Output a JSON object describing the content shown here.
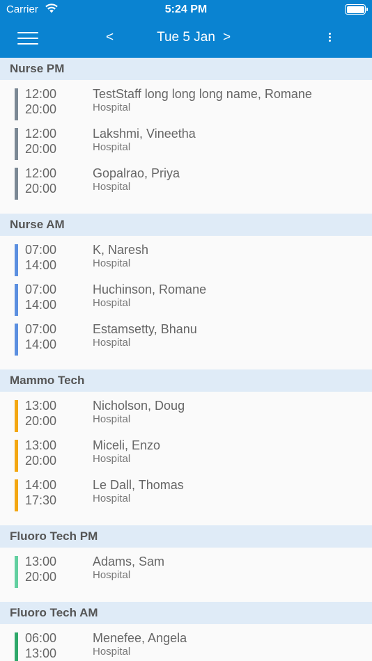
{
  "status": {
    "carrier": "Carrier",
    "time": "5:24 PM"
  },
  "nav": {
    "prev": "<",
    "date": "Tue 5 Jan",
    "next": ">"
  },
  "sections": [
    {
      "title": "Nurse PM",
      "color": "#7b8894",
      "rows": [
        {
          "start": "12:00",
          "end": "20:00",
          "name": "TestStaff long long long name, Romane",
          "place": "Hospital"
        },
        {
          "start": "12:00",
          "end": "20:00",
          "name": "Lakshmi, Vineetha",
          "place": "Hospital"
        },
        {
          "start": "12:00",
          "end": "20:00",
          "name": "Gopalrao, Priya",
          "place": "Hospital"
        }
      ]
    },
    {
      "title": "Nurse AM",
      "color": "#5b8fe0",
      "rows": [
        {
          "start": "07:00",
          "end": "14:00",
          "name": "K, Naresh",
          "place": "Hospital"
        },
        {
          "start": "07:00",
          "end": "14:00",
          "name": "Huchinson, Romane",
          "place": "Hospital"
        },
        {
          "start": "07:00",
          "end": "14:00",
          "name": "Estamsetty, Bhanu",
          "place": "Hospital"
        }
      ]
    },
    {
      "title": "Mammo Tech",
      "color": "#f3a712",
      "rows": [
        {
          "start": "13:00",
          "end": "20:00",
          "name": "Nicholson, Doug",
          "place": "Hospital"
        },
        {
          "start": "13:00",
          "end": "20:00",
          "name": "Miceli, Enzo",
          "place": "Hospital"
        },
        {
          "start": "14:00",
          "end": "17:30",
          "name": "Le Dall, Thomas",
          "place": "Hospital"
        }
      ]
    },
    {
      "title": "Fluoro Tech PM",
      "color": "#62cfa0",
      "rows": [
        {
          "start": "13:00",
          "end": "20:00",
          "name": "Adams, Sam",
          "place": "Hospital"
        }
      ]
    },
    {
      "title": "Fluoro Tech AM",
      "color": "#2ea86a",
      "rows": [
        {
          "start": "06:00",
          "end": "13:00",
          "name": "Menefee, Angela",
          "place": "Hospital"
        }
      ]
    }
  ]
}
